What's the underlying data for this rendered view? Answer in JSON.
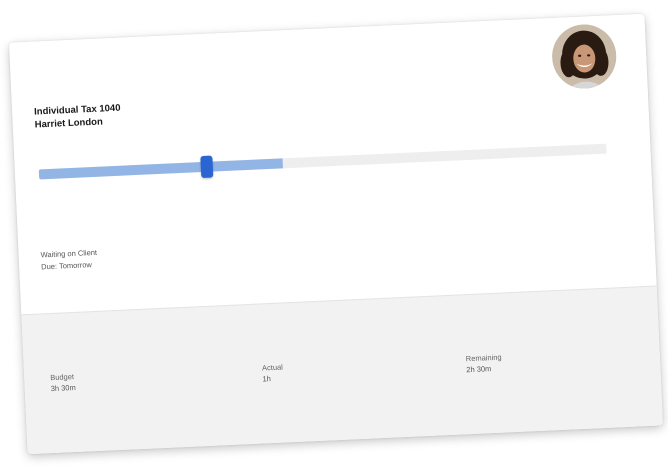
{
  "job": {
    "title": "Individual Tax 1040",
    "client_name": "Harriet London"
  },
  "avatar": {
    "icon": "user-photo"
  },
  "progress": {
    "fill_fraction": 0.43,
    "thumb_fraction": 0.295,
    "fill_color": "#93b5e6",
    "track_color": "#eeeeee",
    "thumb_color": "#2b65d2"
  },
  "status": {
    "state": "Waiting on Client",
    "due": "Due: Tomorrow"
  },
  "time": {
    "budget_label": "Budget",
    "budget_value": "3h 30m",
    "actual_label": "Actual",
    "actual_value": "1h",
    "remaining_label": "Remaining",
    "remaining_value": "2h 30m"
  }
}
